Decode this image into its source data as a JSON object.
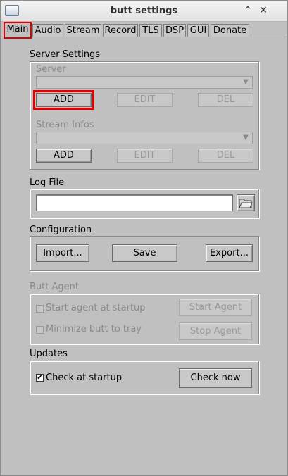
{
  "window": {
    "title": "butt settings"
  },
  "tabs": [
    "Main",
    "Audio",
    "Stream",
    "Record",
    "TLS",
    "DSP",
    "GUI",
    "Donate"
  ],
  "server_settings": {
    "label": "Server Settings",
    "server_label": "Server",
    "server_value": "",
    "stream_infos_label": "Stream Infos",
    "stream_infos_value": "",
    "add": "ADD",
    "edit": "EDIT",
    "del": "DEL"
  },
  "log_file": {
    "label": "Log File",
    "value": ""
  },
  "configuration": {
    "label": "Configuration",
    "import": "Import...",
    "save": "Save",
    "export": "Export..."
  },
  "butt_agent": {
    "label": "Butt Agent",
    "start_at_startup": "Start agent at startup",
    "minimize": "Minimize butt to tray",
    "start_agent": "Start Agent",
    "stop_agent": "Stop Agent"
  },
  "updates": {
    "label": "Updates",
    "check_at_startup": "Check at startup",
    "checked": true,
    "check_now": "Check now"
  },
  "colors": {
    "background": "#c0c0c0",
    "highlight": "#e00000"
  },
  "icons": {
    "window": "window-icon",
    "collapse": "chevron-up-icon",
    "close": "close-icon",
    "folder": "folder-icon",
    "combo": "chevron-down-icon"
  }
}
